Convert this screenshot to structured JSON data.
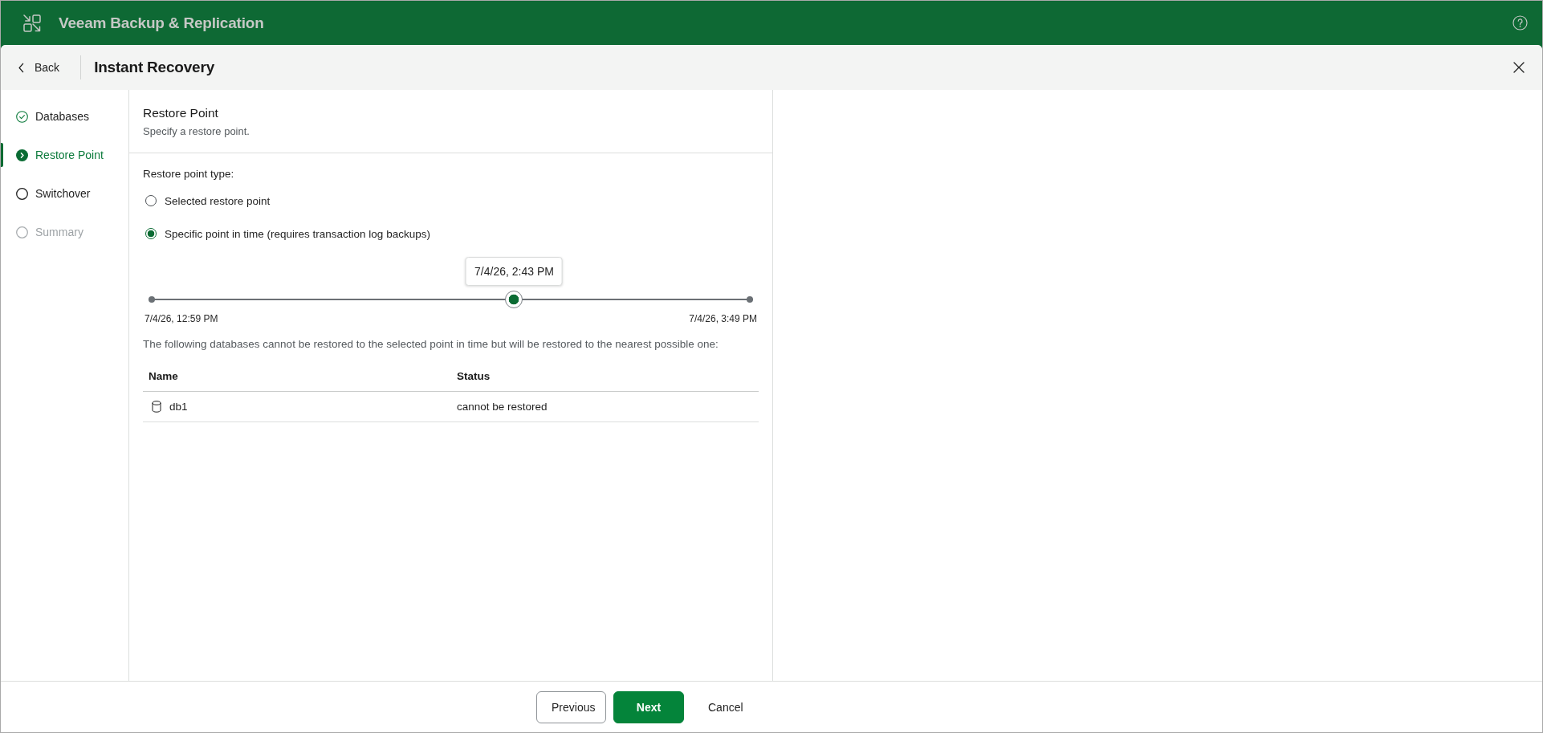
{
  "app_bar": {
    "title": "Veeam Backup & Replication"
  },
  "toolbar": {
    "back_label": "Back",
    "title": "Instant Recovery"
  },
  "steps": [
    {
      "label": "Databases",
      "completed": true,
      "selected": false,
      "disabled": false
    },
    {
      "label": "Restore Point",
      "completed": false,
      "selected": true,
      "disabled": false
    },
    {
      "label": "Switchover",
      "completed": false,
      "selected": false,
      "disabled": false
    },
    {
      "label": "Summary",
      "completed": false,
      "selected": false,
      "disabled": true
    }
  ],
  "step_header": {
    "title": "Restore Point",
    "subtitle": "Specify a restore point."
  },
  "restore_point_type": {
    "label": "Restore point type:",
    "options": [
      {
        "label": "Selected restore point",
        "selected": false
      },
      {
        "label": "Specific point in time (requires transaction log backups)",
        "selected": true
      }
    ]
  },
  "timeline": {
    "tooltip": "7/4/26, 2:43 PM",
    "level": 0.606,
    "start_label": "7/4/26, 12:59 PM",
    "end_label": "7/4/26, 3:49 PM"
  },
  "note": "The following databases cannot be restored to the selected point in time but will be restored to the nearest possible one:",
  "table": {
    "columns": [
      "Name",
      "Status"
    ],
    "rows": [
      {
        "cells": [
          "db1",
          "cannot be restored"
        ]
      }
    ]
  },
  "footer": {
    "buttons": [
      {
        "label": "Previous",
        "kind": "secondary"
      },
      {
        "label": "Next",
        "kind": "primary"
      },
      {
        "label": "Cancel",
        "kind": "plain"
      }
    ]
  }
}
